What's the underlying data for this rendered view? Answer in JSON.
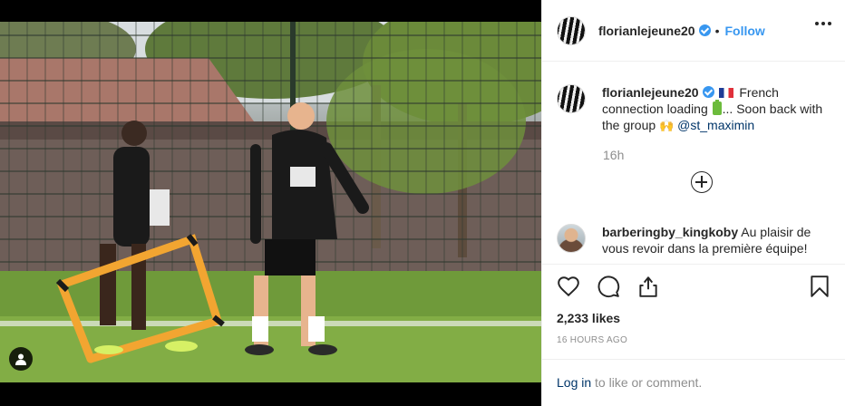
{
  "post": {
    "username": "florianlejeune20",
    "follow_label": "Follow",
    "dot": "•"
  },
  "caption": {
    "username": "florianlejeune20",
    "text_1": "French connection loading",
    "text_2": "... Soon back with the group",
    "mention": "@st_maximin",
    "age": "16h"
  },
  "comment": {
    "username": "barberingby_kingkoby",
    "text": "Au plaisir de vous revoir dans la première équipe!"
  },
  "stats": {
    "likes": "2,233 likes",
    "timestamp": "16 HOURS AGO"
  },
  "login": {
    "link": "Log in",
    "rest": "to like or comment."
  },
  "icons": [
    "more-options-icon",
    "verified-icon",
    "load-more-icon",
    "heart-icon",
    "comment-icon",
    "share-icon",
    "bookmark-icon",
    "user-tag-icon"
  ],
  "colors": {
    "accent": "#3897f0",
    "link": "#003569",
    "muted": "#8e8e8e",
    "text": "#262626"
  }
}
